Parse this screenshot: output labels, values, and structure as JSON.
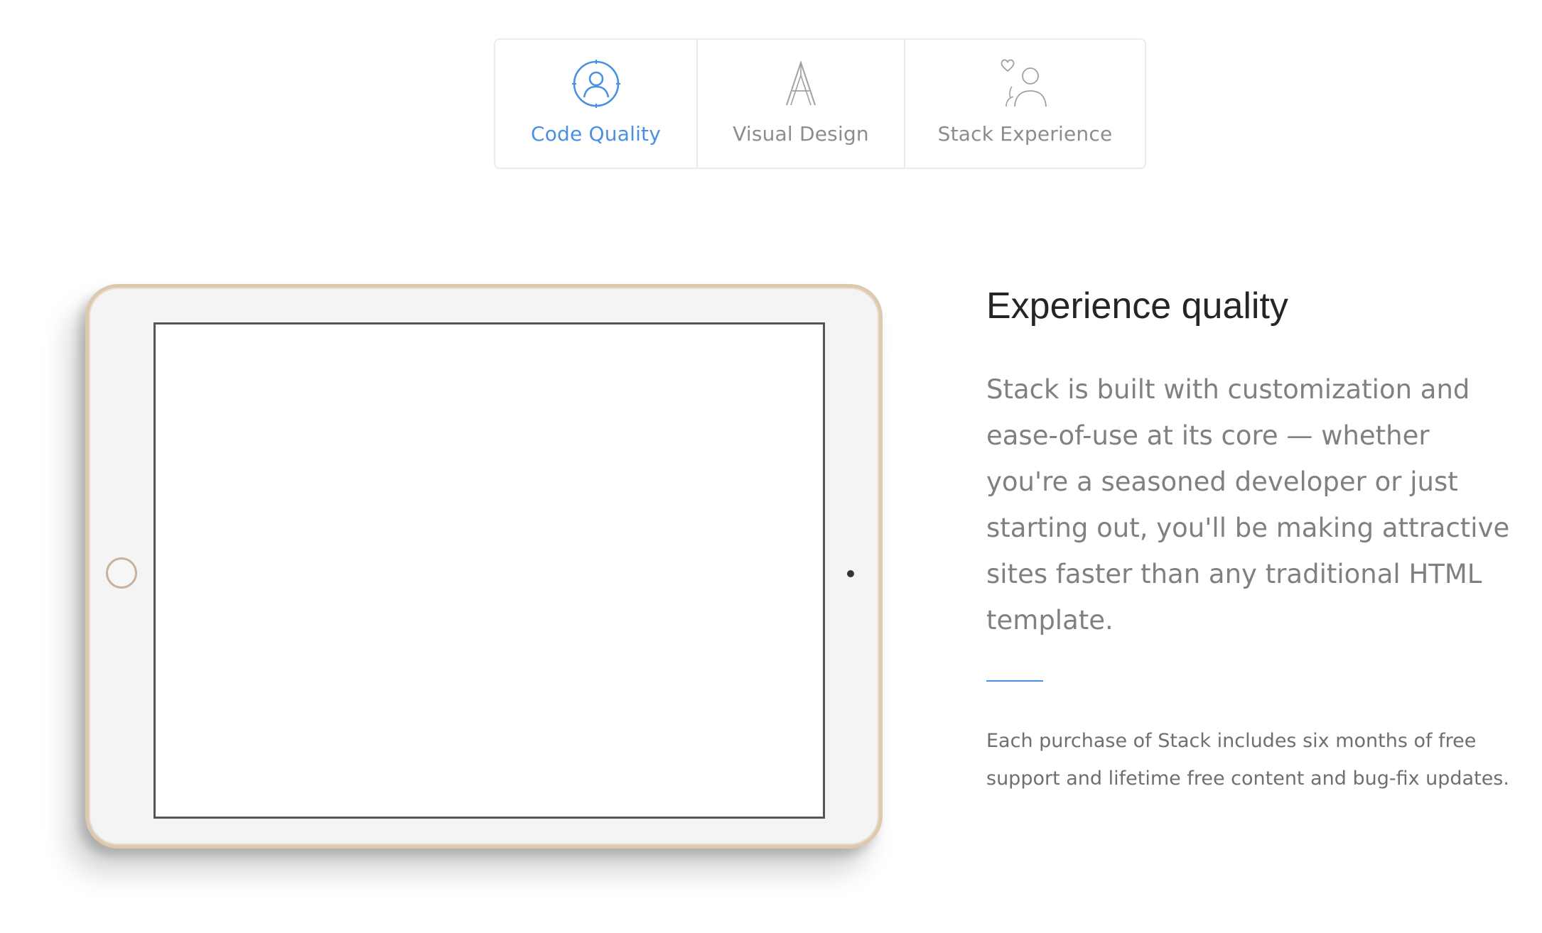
{
  "tabs": [
    {
      "label": "Code Quality",
      "icon": "user-circle-icon",
      "active": true
    },
    {
      "label": "Visual Design",
      "icon": "letter-a-icon",
      "active": false
    },
    {
      "label": "Stack Experience",
      "icon": "people-heart-icon",
      "active": false
    }
  ],
  "feature": {
    "heading": "Experience quality",
    "lead": "Stack is built with customization and ease-of-use at its core — whether you're a seasoned developer or just starting out, you'll be making attractive sites faster than any traditional HTML template.",
    "note": "Each purchase of Stack includes six months of free support and lifetime free content and bug-fix updates."
  },
  "colors": {
    "accent": "#4a90e2",
    "inactive_label": "#8c8c8c",
    "heading": "#252525",
    "body_text": "#808080",
    "tablet_frame": "#ddc8b0"
  }
}
